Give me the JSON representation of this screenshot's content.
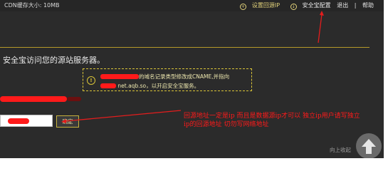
{
  "topbar": {
    "cache_label": "CDN缓存大小: 10MB",
    "set_origin_ip": "设置回源IP",
    "security_settings": "安全宝配置",
    "logout": "退出",
    "help": "帮助"
  },
  "main": {
    "heading": "安全宝访问您的源站服务器。",
    "notice_line1_suffix": "的域名记录类型修改成CNAME,并指向",
    "notice_line2_suffix": "net.aqb.so，以开启安全宝服务。",
    "confirm_label": "确定",
    "back_to_top": "向上收起"
  },
  "annotation": {
    "text": "回源地址一定是ip 而且是数据源ip才可以 独立ip用户请写独立ip的回源地址 切勿写网络地址"
  },
  "icons": {
    "set_origin": "settings-circle-icon",
    "security": "arrow-circle-icon",
    "warning": "warning-icon",
    "back_top": "up-arrow-icon"
  },
  "colors": {
    "background": "#2b2b2b",
    "accent_yellow": "#d9c438",
    "annotation_red": "#ff1a1a"
  }
}
